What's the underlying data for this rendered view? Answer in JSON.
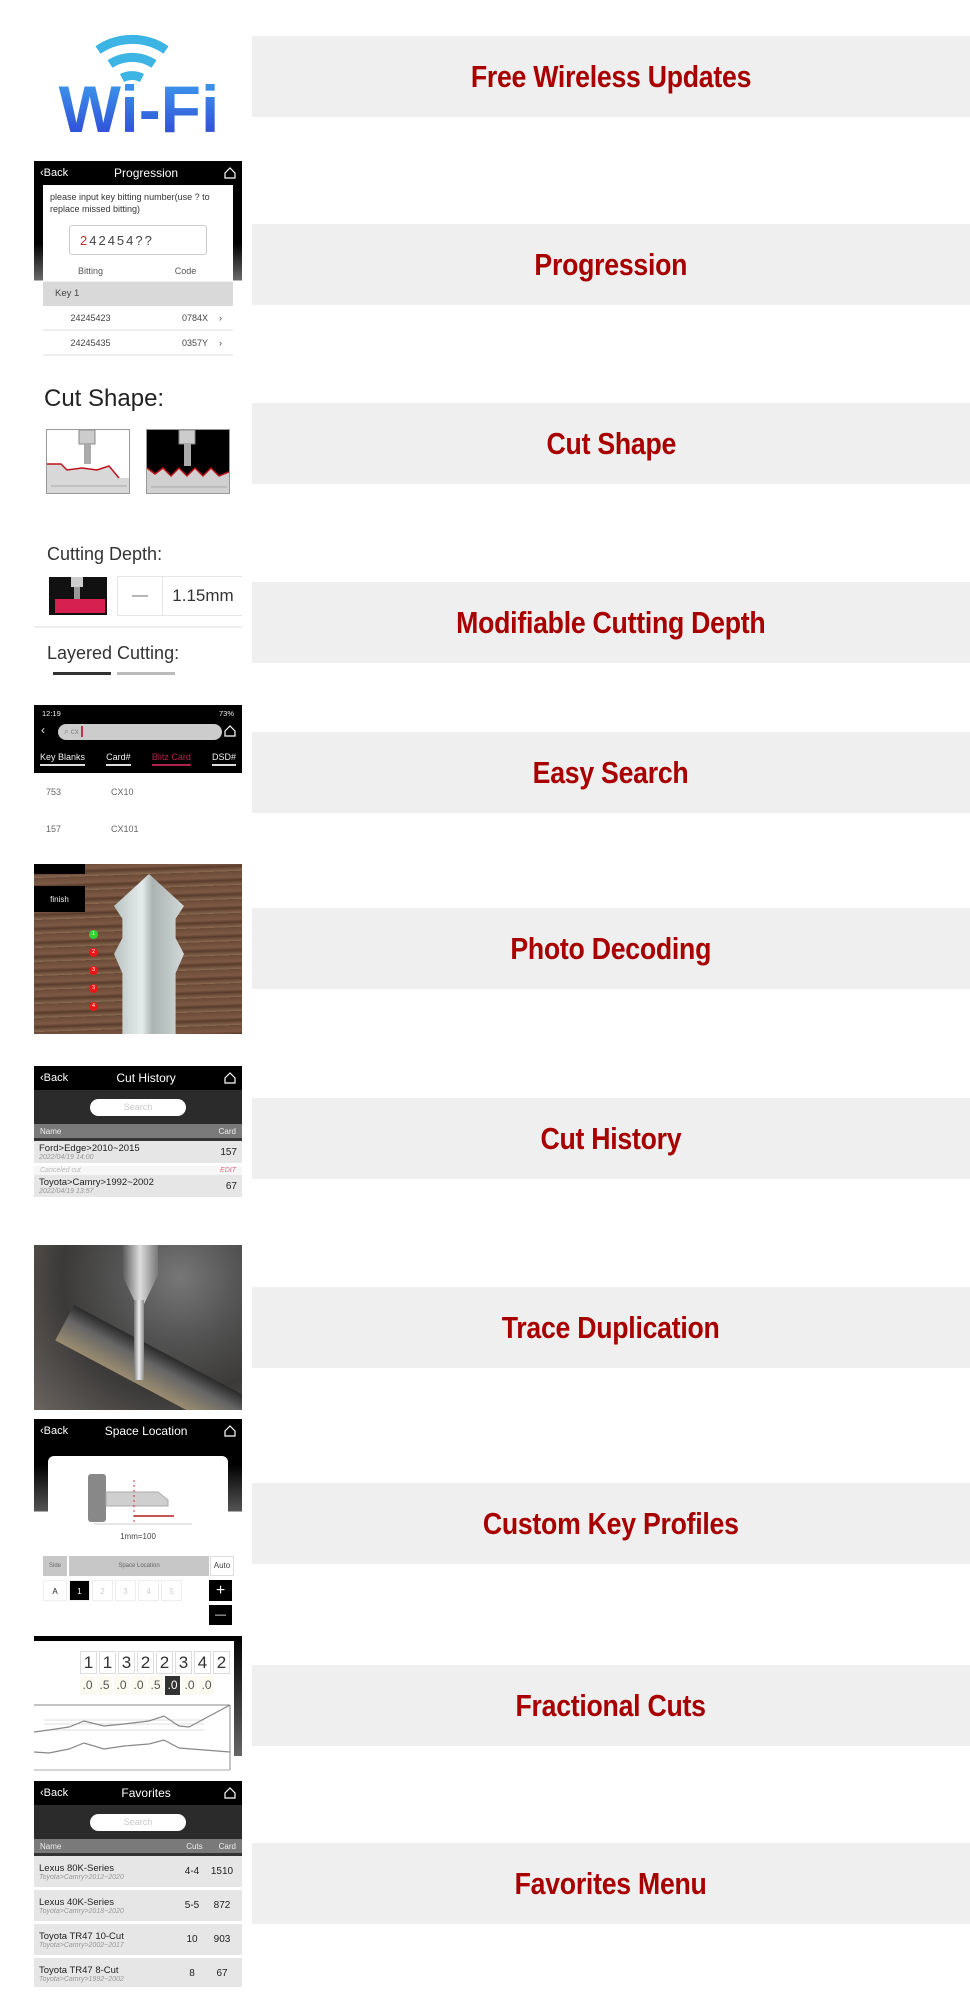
{
  "features": [
    {
      "title": "Free Wireless Updates"
    },
    {
      "title": "Progression"
    },
    {
      "title": "Cut Shape"
    },
    {
      "title": "Modifiable Cutting Depth"
    },
    {
      "title": "Easy Search"
    },
    {
      "title": "Photo Decoding"
    },
    {
      "title": "Cut History"
    },
    {
      "title": "Trace Duplication"
    },
    {
      "title": "Custom Key Profiles"
    },
    {
      "title": "Fractional Cuts"
    },
    {
      "title": "Favorites Menu"
    }
  ],
  "wifi_logo": {
    "text": "Wi-Fi",
    "color_top": "#3fb6e8",
    "color_bottom": "#2e43d6"
  },
  "progression": {
    "back_label": "Back",
    "title": "Progression",
    "hint": "please input key bitting number(use ? to replace missed bitting)",
    "input_first": "2",
    "input_rest": "42454??",
    "col_bitting": "Bitting",
    "col_code": "Code",
    "group": "Key 1",
    "rows": [
      {
        "bitting": "24245423",
        "code": "0784X"
      },
      {
        "bitting": "24245435",
        "code": "0357Y"
      }
    ]
  },
  "cut_shape": {
    "label": "Cut Shape:"
  },
  "cutting_depth": {
    "label": "Cutting Depth:",
    "minus": "—",
    "value": "1.15mm",
    "layered_label": "Layered Cutting:"
  },
  "easy_search": {
    "status_time": "12:19",
    "status_right": "73%",
    "search_value": "cx",
    "tabs": [
      "Key Blanks",
      "Card#",
      "Blitz Card",
      "DSD#"
    ],
    "active_tab": "Blitz Card",
    "results": [
      {
        "a": "753",
        "b": "CX10"
      },
      {
        "a": "157",
        "b": "CX101"
      }
    ]
  },
  "photo_decoding": {
    "finish_label": "finish",
    "points": [
      "1",
      "2",
      "3",
      "3",
      "4"
    ]
  },
  "cut_history": {
    "back_label": "Back",
    "title": "Cut History",
    "search_placeholder": "Search",
    "col_name": "Name",
    "col_card": "Card",
    "rows": [
      {
        "name": "Ford>Edge>2010~2015",
        "date": "2022/04/19 14:00",
        "card": "157"
      },
      {
        "name": "Toyota>Camry>1992~2002",
        "date": "2022/04/19 13:57",
        "card": "67"
      }
    ],
    "canceled_label": "Canceled cut",
    "edit_label": "EDIT"
  },
  "space_location": {
    "back_label": "Back",
    "title": "Space Location",
    "scale": "1mm=100",
    "col_side": "Side",
    "col_space": "Space Location",
    "auto_label": "Auto",
    "side_value": "A",
    "cells": [
      "1",
      "2",
      "3",
      "4",
      "5"
    ],
    "selected_cell": "1",
    "plus": "+",
    "minus": "—"
  },
  "fractional": {
    "digits": [
      "1",
      "1",
      "3",
      "2",
      "2",
      "3",
      "4",
      "2"
    ],
    "fractions": [
      ".0",
      ".5",
      ".0",
      ".0",
      ".5",
      ".0",
      ".0",
      ".0"
    ],
    "selected_index": 5
  },
  "favorites": {
    "back_label": "Back",
    "title": "Favorites",
    "search_placeholder": "Search",
    "col_name": "Name",
    "col_cuts": "Cuts",
    "col_card": "Card",
    "rows": [
      {
        "name": "Lexus 80K-Series",
        "sub": "Toyota>Camry>2012~2020",
        "cuts": "4-4",
        "card": "1510"
      },
      {
        "name": "Lexus 40K-Series",
        "sub": "Toyota>Camry>2018~2020",
        "cuts": "5-5",
        "card": "872"
      },
      {
        "name": "Toyota TR47 10-Cut",
        "sub": "Toyota>Camry>2002~2017",
        "cuts": "10",
        "card": "903"
      },
      {
        "name": "Toyota TR47 8-Cut",
        "sub": "Toyota>Camry>1992~2002",
        "cuts": "8",
        "card": "67"
      }
    ]
  }
}
